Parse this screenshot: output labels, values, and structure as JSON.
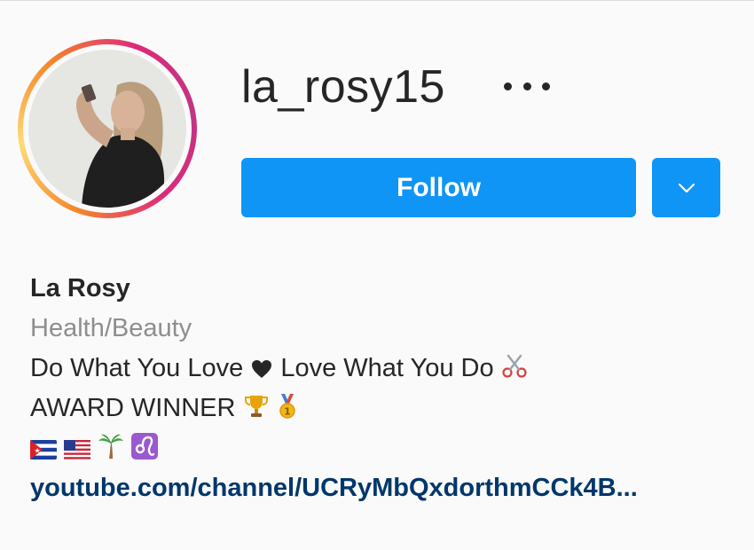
{
  "profile": {
    "username": "la_rosy15",
    "display_name": "La Rosy",
    "category": "Health/Beauty",
    "bio_lines": [
      "Do What You Love",
      "Love What You Do",
      "AWARD WINNER"
    ],
    "link": "youtube.com/channel/UCRyMbQxdorthmCCk4B..."
  },
  "actions": {
    "follow_label": "Follow"
  },
  "icons": {
    "more": "ellipsis-icon",
    "dropdown": "chevron-down-icon",
    "heart": "black-heart-icon",
    "scissors": "scissors-icon",
    "trophy": "trophy-icon",
    "medal": "gold-medal-icon",
    "flags": [
      "cuba-flag-icon",
      "usa-flag-icon"
    ],
    "palm": "palm-tree-icon",
    "zodiac": "leo-icon"
  },
  "colors": {
    "follow_button": "#0f95f6",
    "link": "#00376b",
    "category": "#8e8e8e",
    "text": "#262626"
  }
}
